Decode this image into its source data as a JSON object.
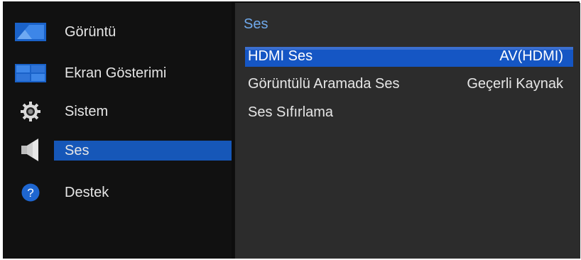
{
  "sidebar": {
    "items": [
      {
        "label": "Görüntü",
        "icon": "picture-icon"
      },
      {
        "label": "Ekran Gösterimi",
        "icon": "onscreen-display-icon"
      },
      {
        "label": "Sistem",
        "icon": "gear-icon"
      },
      {
        "label": "Ses",
        "icon": "speaker-icon",
        "selected": true
      },
      {
        "label": "Destek",
        "icon": "help-icon"
      }
    ]
  },
  "panel": {
    "title": "Ses",
    "rows": [
      {
        "label": "HDMI Ses",
        "value": "AV(HDMI)",
        "selected": true
      },
      {
        "label": "Görüntülü Aramada Ses",
        "value": "Geçerli Kaynak"
      },
      {
        "label": "Ses Sıfırlama",
        "value": ""
      }
    ]
  },
  "colors": {
    "accent": "#1657b8",
    "title": "#6fa8ea",
    "background": "#111111",
    "panel": "#2c2c2c"
  }
}
